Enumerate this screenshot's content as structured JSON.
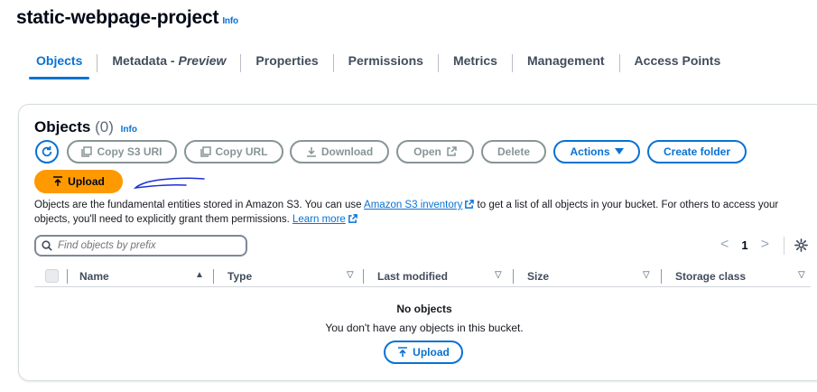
{
  "header": {
    "title": "static-webpage-project",
    "info": "Info"
  },
  "tabs": [
    {
      "label": "Objects",
      "active": true
    },
    {
      "label": "Metadata - ",
      "label_em": "Preview"
    },
    {
      "label": "Properties"
    },
    {
      "label": "Permissions"
    },
    {
      "label": "Metrics"
    },
    {
      "label": "Management"
    },
    {
      "label": "Access Points"
    }
  ],
  "objects_panel": {
    "title": "Objects",
    "count": "(0)",
    "info": "Info",
    "toolbar": {
      "copy_s3_uri": "Copy S3 URI",
      "copy_url": "Copy URL",
      "download": "Download",
      "open": "Open",
      "delete": "Delete",
      "actions": "Actions",
      "create_folder": "Create folder",
      "upload": "Upload"
    },
    "description": {
      "part1": "Objects are the fundamental entities stored in Amazon S3. You can use ",
      "link1": "Amazon S3 inventory",
      "part2": " to get a list of all objects in your bucket. For others to access your objects, you'll need to explicitly grant them permissions. ",
      "link2": "Learn more"
    },
    "search": {
      "placeholder": "Find objects by prefix",
      "value": ""
    },
    "pagination": {
      "prev": "<",
      "page": "1",
      "next": ">"
    },
    "columns": [
      "Name",
      "Type",
      "Last modified",
      "Size",
      "Storage class"
    ],
    "empty": {
      "title": "No objects",
      "subtitle": "You don't have any objects in this bucket.",
      "upload": "Upload"
    }
  },
  "colors": {
    "accent": "#0972d3",
    "upload_primary": "#ff9900",
    "disabled": "#879596"
  }
}
